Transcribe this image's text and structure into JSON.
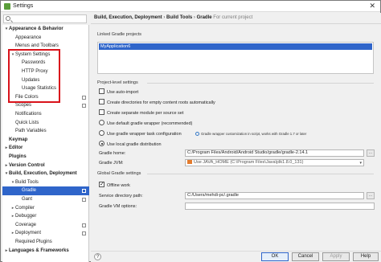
{
  "window": {
    "title": "Settings",
    "close_glyph": "✕"
  },
  "search": {
    "placeholder": ""
  },
  "sidebar": {
    "items": [
      {
        "label": "Appearance & Behavior",
        "toggle": "▾",
        "bold": true,
        "selected": false
      },
      {
        "label": "Appearance",
        "toggle": "",
        "bold": false,
        "selected": false
      },
      {
        "label": "Menus and Toolbars",
        "toggle": "",
        "bold": false,
        "selected": false
      },
      {
        "label": "System Settings",
        "toggle": "▾",
        "bold": false,
        "selected": false
      },
      {
        "label": "Passwords",
        "toggle": "",
        "bold": false,
        "selected": false
      },
      {
        "label": "HTTP Proxy",
        "toggle": "",
        "bold": false,
        "selected": false
      },
      {
        "label": "Updates",
        "toggle": "",
        "bold": false,
        "selected": false
      },
      {
        "label": "Usage Statistics",
        "toggle": "",
        "bold": false,
        "selected": false
      },
      {
        "label": "File Colors",
        "toggle": "",
        "bold": false,
        "selected": false
      },
      {
        "label": "Scopes",
        "toggle": "",
        "bold": false,
        "selected": false
      },
      {
        "label": "Notifications",
        "toggle": "",
        "bold": false,
        "selected": false
      },
      {
        "label": "Quick Lists",
        "toggle": "",
        "bold": false,
        "selected": false
      },
      {
        "label": "Path Variables",
        "toggle": "",
        "bold": false,
        "selected": false
      },
      {
        "label": "Keymap",
        "toggle": "",
        "bold": true,
        "selected": false
      },
      {
        "label": "Editor",
        "toggle": "▸",
        "bold": true,
        "selected": false
      },
      {
        "label": "Plugins",
        "toggle": "",
        "bold": true,
        "selected": false
      },
      {
        "label": "Version Control",
        "toggle": "▸",
        "bold": true,
        "selected": false
      },
      {
        "label": "Build, Execution, Deployment",
        "toggle": "▾",
        "bold": true,
        "selected": false
      },
      {
        "label": "Build Tools",
        "toggle": "▾",
        "bold": false,
        "selected": false
      },
      {
        "label": "Gradle",
        "toggle": "",
        "bold": false,
        "selected": true
      },
      {
        "label": "Gant",
        "toggle": "",
        "bold": false,
        "selected": false
      },
      {
        "label": "Compiler",
        "toggle": "▸",
        "bold": false,
        "selected": false
      },
      {
        "label": "Debugger",
        "toggle": "▸",
        "bold": false,
        "selected": false
      },
      {
        "label": "Coverage",
        "toggle": "",
        "bold": false,
        "selected": false
      },
      {
        "label": "Deployment",
        "toggle": "▸",
        "bold": false,
        "selected": false
      },
      {
        "label": "Required Plugins",
        "toggle": "",
        "bold": false,
        "selected": false
      },
      {
        "label": "Languages & Frameworks",
        "toggle": "▸",
        "bold": true,
        "selected": false
      }
    ]
  },
  "breadcrumb": {
    "part1": "Build, Execution, Deployment",
    "sep": "›",
    "part2": "Build Tools",
    "part3": "Gradle",
    "current_note": "For current project"
  },
  "linked_projects": {
    "label": "Linked Gradle projects",
    "items": [
      "MyApplication6"
    ]
  },
  "project_settings": {
    "label": "Project-level settings",
    "use_auto_import": {
      "label": "Use auto-import",
      "checked": false
    },
    "create_dirs": {
      "label": "Create directories for empty content roots automatically",
      "checked": false
    },
    "create_module": {
      "label": "Create separate module per source set",
      "checked": false
    },
    "default_wrapper": {
      "label": "Use default gradle wrapper (recommended)",
      "selected": false
    },
    "wrapper_task": {
      "label": "Use gradle wrapper task configuration",
      "selected": false
    },
    "wrapper_hint": "Gradle wrapper customization in script, works with Gradle 1.7 or later",
    "local_dist": {
      "label": "Use local gradle distribution",
      "selected": true
    },
    "gradle_home": {
      "label": "Gradle home:",
      "value": "C:/Program Files/Android/Android Studio/gradle/gradle-2.14.1"
    },
    "gradle_jvm": {
      "label": "Gradle JVM:",
      "value": "Use JAVA_HOME (C:\\Program Files\\Java\\jdk1.8.0_131)"
    }
  },
  "global_settings": {
    "label": "Global Gradle settings",
    "offline": {
      "label": "Offline work",
      "checked": true
    },
    "service_dir": {
      "label": "Service directory path:",
      "value": "C:/Users/mehdi-pc/.gradle"
    },
    "vm_options": {
      "label": "Gradle VM options:",
      "value": ""
    }
  },
  "footer": {
    "help": "?",
    "ok": "OK",
    "cancel": "Cancel",
    "apply": "Apply",
    "help_label": "Help"
  },
  "browse_glyph": "...",
  "colors": {
    "selection": "#2f65ca",
    "highlight_box": "#d9131b"
  },
  "icons": [
    "settings-app-icon",
    "search-icon",
    "config-icon",
    "java-icon",
    "info-icon"
  ]
}
